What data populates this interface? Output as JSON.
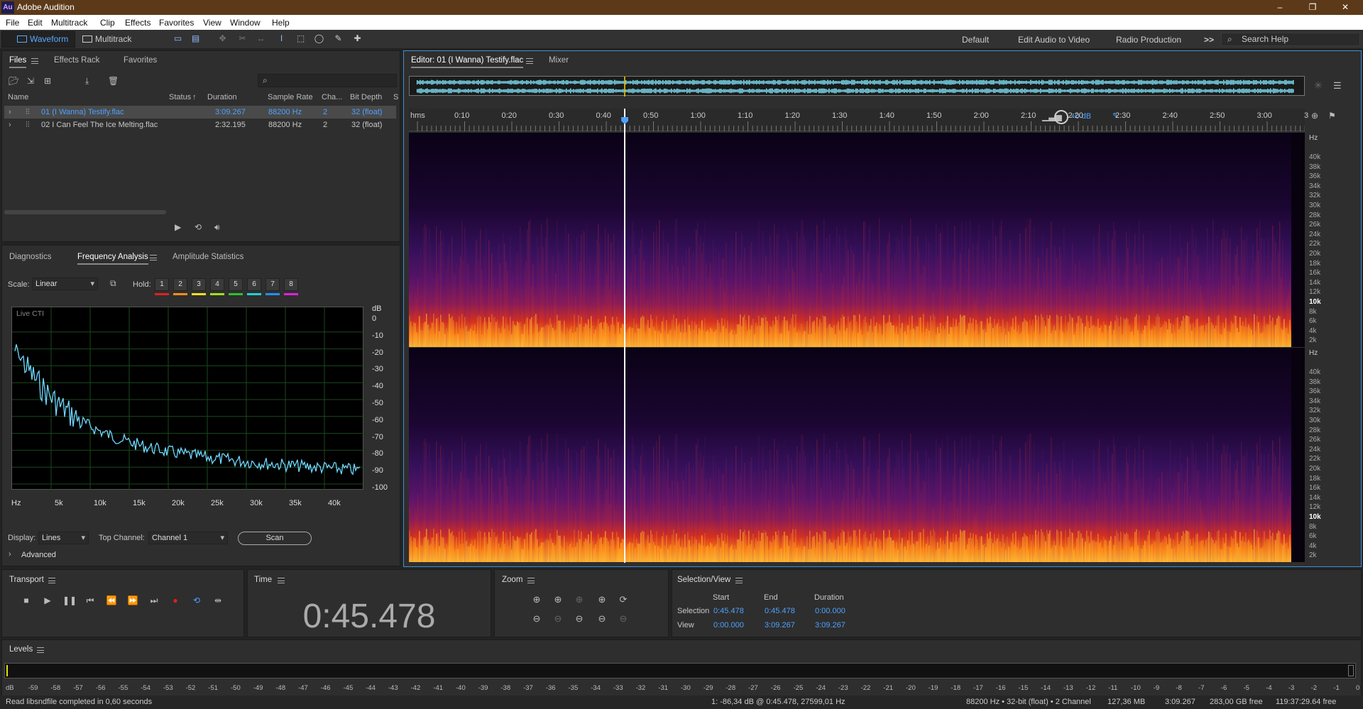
{
  "app": {
    "title": "Adobe Audition",
    "logo": "Au"
  },
  "window_controls": {
    "minimize": "–",
    "maximize": "❐",
    "close": "✕"
  },
  "menu": [
    "File",
    "Edit",
    "Multitrack",
    "Clip",
    "Effects",
    "Favorites",
    "View",
    "Window",
    "Help"
  ],
  "toolbar": {
    "modes": [
      {
        "label": "Waveform",
        "active": true
      },
      {
        "label": "Multitrack",
        "active": false
      }
    ],
    "workspaces": [
      "Default",
      "Edit Audio to Video",
      "Radio Production"
    ],
    "more": ">>",
    "search_placeholder": "Search Help"
  },
  "files_panel": {
    "tabs": [
      "Files",
      "Effects Rack",
      "Favorites"
    ],
    "columns": [
      "Name",
      "Status",
      "Duration",
      "Sample Rate",
      "Cha...",
      "Bit Depth",
      "S"
    ],
    "status_sort_icon": "↑",
    "files": [
      {
        "name": "01 (I Wanna) Testify.flac",
        "status": "",
        "duration": "3:09.267",
        "sample_rate": "88200 Hz",
        "channels": "2",
        "bit_depth": "32 (float)",
        "selected": true
      },
      {
        "name": "02 I Can Feel The Ice Melting.flac",
        "status": "",
        "duration": "2:32.195",
        "sample_rate": "88200 Hz",
        "channels": "2",
        "bit_depth": "32 (float)",
        "selected": false
      }
    ]
  },
  "analysis_panel": {
    "tabs": [
      "Diagnostics",
      "Frequency Analysis",
      "Amplitude Statistics"
    ],
    "scale_label": "Scale:",
    "scale_value": "Linear",
    "hold_label": "Hold:",
    "hold_buttons": [
      "1",
      "2",
      "3",
      "4",
      "5",
      "6",
      "7",
      "8"
    ],
    "hold_colors": [
      "#e02020",
      "#ff8c1a",
      "#f0e020",
      "#a0e020",
      "#30c030",
      "#20d0d0",
      "#2090ff",
      "#e020e0"
    ],
    "graph_title": "Live CTI",
    "db_unit": "dB",
    "db_labels": [
      "0",
      "-10",
      "-20",
      "-30",
      "-40",
      "-50",
      "-60",
      "-70",
      "-80",
      "-90",
      "-100"
    ],
    "freq_labels": [
      "Hz",
      "5k",
      "10k",
      "15k",
      "20k",
      "25k",
      "30k",
      "35k",
      "40k"
    ],
    "display_label": "Display:",
    "display_value": "Lines",
    "top_channel_label": "Top Channel:",
    "top_channel_value": "Channel 1",
    "scan_label": "Scan",
    "advanced_label": "Advanced"
  },
  "editor": {
    "tab_label": "Editor: 01 (I Wanna) Testify.flac",
    "mixer_label": "Mixer",
    "ruler_labels": [
      "hms",
      "0:10",
      "0:20",
      "0:30",
      "0:40",
      "0:50",
      "1:00",
      "1:10",
      "1:20",
      "1:30",
      "1:40",
      "1:50",
      "2:00",
      "2:10",
      "2:20",
      "2:30",
      "2:40",
      "2:50",
      "3:00",
      "3"
    ],
    "volume_label": "+0 dB",
    "hz_unit": "Hz",
    "hz_labels": [
      "40k",
      "38k",
      "36k",
      "34k",
      "32k",
      "30k",
      "28k",
      "26k",
      "24k",
      "22k",
      "20k",
      "18k",
      "16k",
      "14k",
      "12k",
      "10k",
      "8k",
      "6k",
      "4k",
      "2k"
    ],
    "playhead_fraction": 0.2402
  },
  "transport": {
    "title": "Transport"
  },
  "time_panel": {
    "title": "Time",
    "value": "0:45.478"
  },
  "zoom_panel": {
    "title": "Zoom"
  },
  "selection_panel": {
    "title": "Selection/View",
    "headers": [
      "Start",
      "End",
      "Duration"
    ],
    "rows": [
      {
        "label": "Selection",
        "start": "0:45.478",
        "end": "0:45.478",
        "duration": "0:00.000"
      },
      {
        "label": "View",
        "start": "0:00.000",
        "end": "3:09.267",
        "duration": "3:09.267"
      }
    ]
  },
  "levels": {
    "title": "Levels",
    "scale": [
      "dB",
      "-59",
      "-58",
      "-57",
      "-56",
      "-55",
      "-54",
      "-53",
      "-52",
      "-51",
      "-50",
      "-49",
      "-48",
      "-47",
      "-46",
      "-45",
      "-44",
      "-43",
      "-42",
      "-41",
      "-40",
      "-39",
      "-38",
      "-37",
      "-36",
      "-35",
      "-34",
      "-33",
      "-32",
      "-31",
      "-30",
      "-29",
      "-28",
      "-27",
      "-26",
      "-25",
      "-24",
      "-23",
      "-22",
      "-21",
      "-20",
      "-19",
      "-18",
      "-17",
      "-16",
      "-15",
      "-14",
      "-13",
      "-12",
      "-11",
      "-10",
      "-9",
      "-8",
      "-7",
      "-6",
      "-5",
      "-4",
      "-3",
      "-2",
      "-1",
      "0"
    ]
  },
  "statusbar": {
    "message": "Read libsndfile completed in 0,60 seconds",
    "cursor_info": "1: -86,34 dB @ 0:45.478, 27599,01 Hz",
    "format": "88200 Hz • 32-bit (float) • 2 Channel",
    "size": "127,36 MB",
    "duration": "3:09.267",
    "free_space": "283,00 GB free",
    "free_time": "119:37:29.64 free"
  },
  "colors": {
    "accent": "#4da2ff",
    "playhead": "#ffffff",
    "waveform": "#7fe7ff",
    "titlebar": "#5c3a19"
  }
}
